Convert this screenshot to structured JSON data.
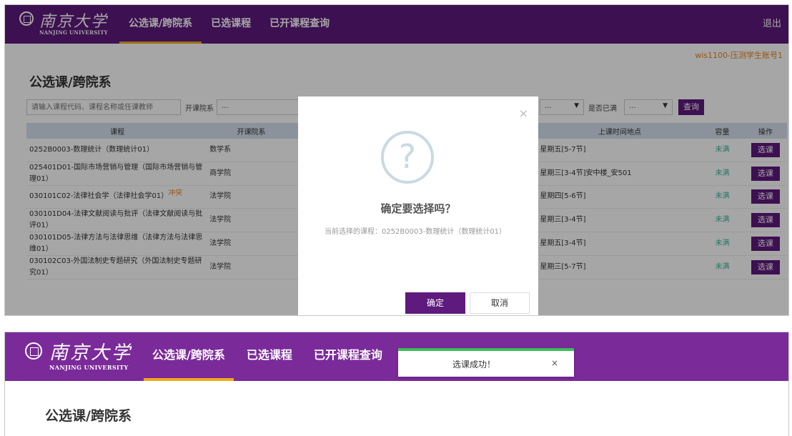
{
  "brand": {
    "name_cn": "南京大学",
    "name_en": "NANJING UNIVERSITY"
  },
  "colors": {
    "brand_purple": "#5f1a7d",
    "nav_active_underline": "#f1a81b",
    "capacity_text": "#37b89a",
    "user_text": "#e8851e",
    "toast_success": "#3bbd58"
  },
  "nav": [
    {
      "label": "公选课/跨院系",
      "active": true
    },
    {
      "label": "已选课程",
      "active": false
    },
    {
      "label": "已开课程查询",
      "active": false
    }
  ],
  "logout_label": "退出",
  "user_account": "wis1100-压测学生账号1",
  "page_title": "公选课/跨院系",
  "filters": {
    "search_placeholder": "请输入课程代码、课程名称或任课教师",
    "dept_label": "开课院系",
    "dept_value": "...",
    "time_value": "...",
    "full_label": "是否已满",
    "full_value": "...",
    "query_label": "查询"
  },
  "table": {
    "headers": [
      "课程",
      "开课院系",
      "",
      "上课时间地点",
      "容量",
      "操作"
    ],
    "rows": [
      {
        "course": "0252B0003-数理统计（数理统计01）",
        "conflict": "",
        "dept": "数学系",
        "time": "星期五[5-7节]",
        "capacity": "未满",
        "action": "选课"
      },
      {
        "course": "025401D01-国际市场营销与管理（国际市场营销与管理01）",
        "conflict": "",
        "dept": "商学院",
        "time": "星期三[3-4节]安中楼_安501",
        "capacity": "未满",
        "action": "选课"
      },
      {
        "course": "030101C02-法律社会学（法律社会学01）",
        "conflict": "冲突",
        "dept": "法学院",
        "time": "星期四[5-6节]",
        "capacity": "未满",
        "action": "选课"
      },
      {
        "course": "030101D04-法律文献阅读与批评（法律文献阅读与批评01）",
        "conflict": "",
        "dept": "法学院",
        "time": "星期三[3-4节]",
        "capacity": "未满",
        "action": "选课"
      },
      {
        "course": "030101D05-法律方法与法律思维（法律方法与法律思维01）",
        "conflict": "",
        "dept": "法学院",
        "time": "星期五[3-4节]",
        "capacity": "未满",
        "action": "选课"
      },
      {
        "course": "030102C03-外国法制史专题研究（外国法制史专题研究01）",
        "conflict": "",
        "dept": "法学院",
        "time": "星期三[5-7节]",
        "capacity": "未满",
        "action": "选课"
      }
    ]
  },
  "modal": {
    "icon": "question-icon",
    "title": "确定要选择吗？",
    "desc": "当前选择的课程：0252B0003-数理统计（数理统计01）",
    "confirm": "确定",
    "cancel": "取消",
    "close": "×"
  },
  "toast": {
    "message": "选课成功！",
    "close": "×"
  }
}
